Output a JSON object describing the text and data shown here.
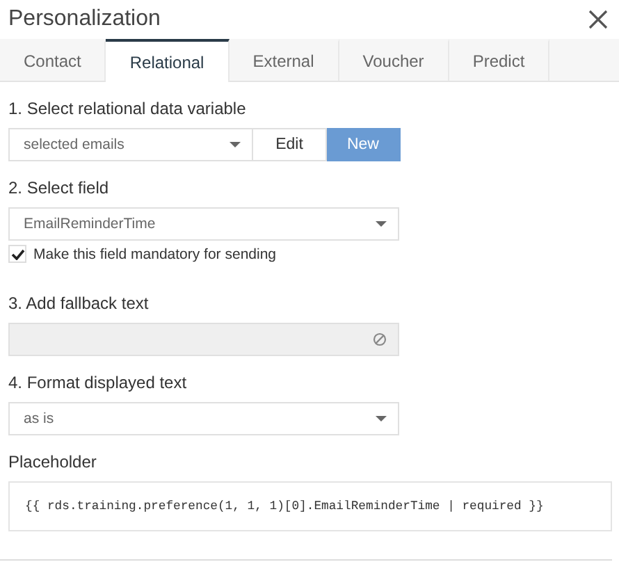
{
  "window": {
    "title": "Personalization"
  },
  "tabs": [
    {
      "label": "Contact",
      "selected": false
    },
    {
      "label": "Relational",
      "selected": true
    },
    {
      "label": "External",
      "selected": false
    },
    {
      "label": "Voucher",
      "selected": false
    },
    {
      "label": "Predict",
      "selected": false
    }
  ],
  "variable": {
    "label": "1. Select relational data variable",
    "value": "selected emails",
    "buttons": [
      {
        "label": "Edit",
        "primary": false
      },
      {
        "label": "New",
        "primary": true
      }
    ]
  },
  "field": {
    "label": "2. Select field",
    "value": "EmailReminderTime",
    "mandatory": {
      "label": "Make this field mandatory for sending",
      "checked": true
    }
  },
  "fallback": {
    "label": "3. Add fallback text",
    "disabled": true
  },
  "format": {
    "label": "4. Format displayed text",
    "value": "as is"
  },
  "placeholder": {
    "label": "Placeholder",
    "code": "{{ rds.training.preference(1, 1, 1)[0].EmailReminderTime | required }}"
  }
}
